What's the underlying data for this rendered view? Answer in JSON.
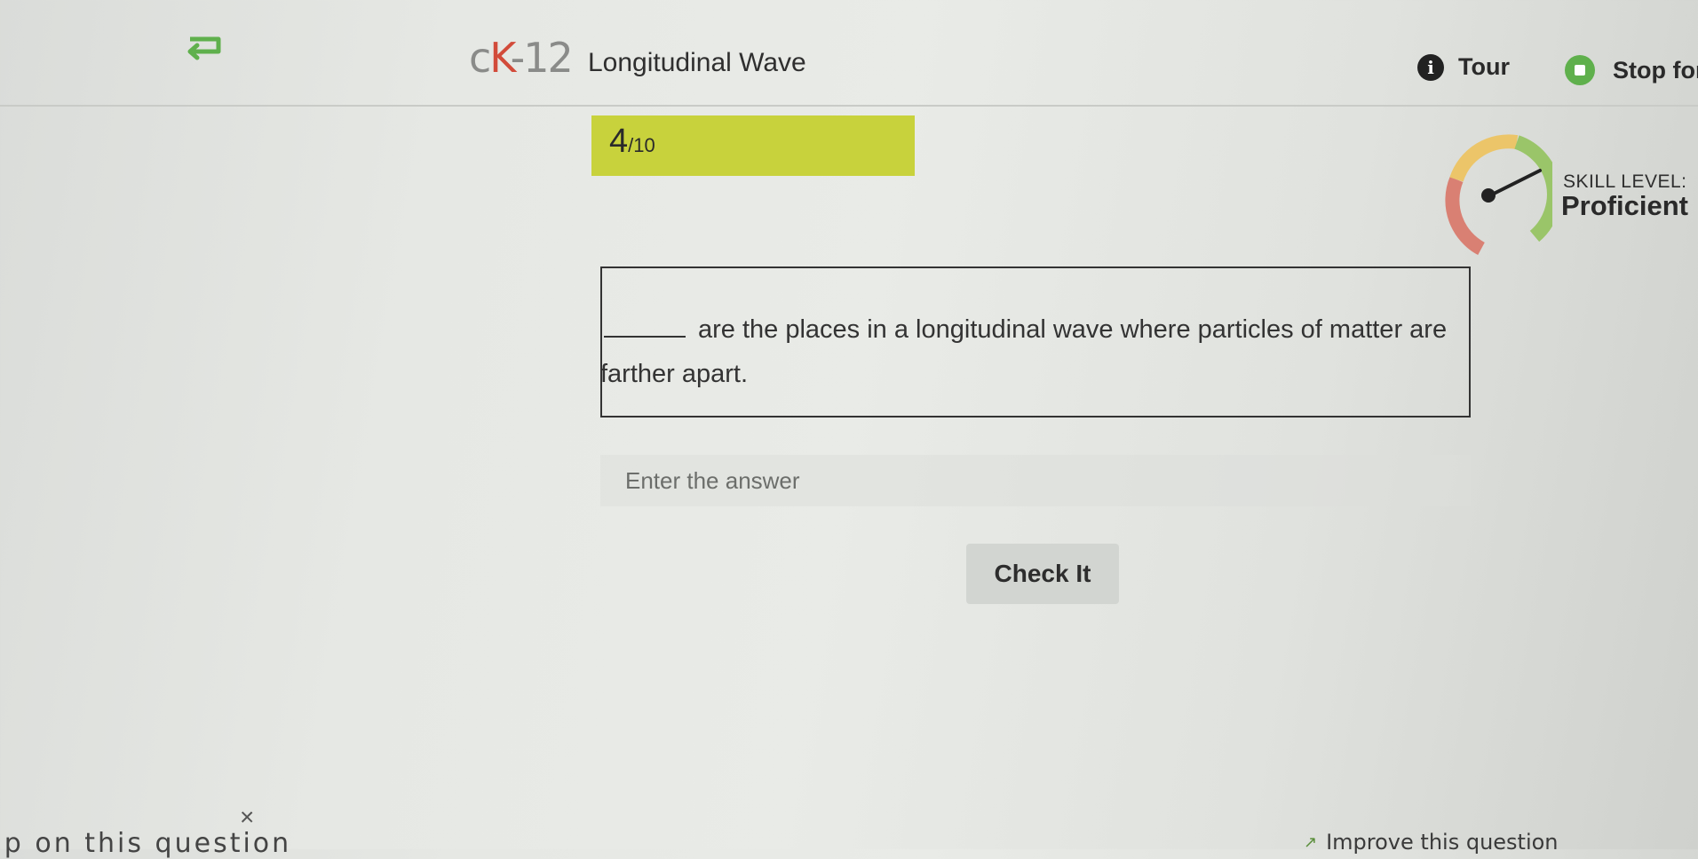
{
  "header": {
    "back_icon": "return-arrow-icon",
    "logo": {
      "c": "c",
      "k": "K",
      "num": "-12"
    },
    "concept_title": "Longitudinal Wave",
    "tour_label": "Tour",
    "tour_icon": "info-icon",
    "stop_label": "Stop for",
    "stop_icon": "stop-icon",
    "brand_green": "#5fb04c",
    "logo_red": "#d24b3a"
  },
  "progress": {
    "current": "4",
    "total": "/10",
    "color": "#c8d23c"
  },
  "skill": {
    "label": "SKILL LEVEL:",
    "value": "Proficient",
    "gauge_icon": "skill-gauge-icon"
  },
  "question": {
    "text_after_blank": "are the places in a longitudinal wave where particles of matter are farther apart."
  },
  "answer": {
    "placeholder": "Enter the answer",
    "value": ""
  },
  "check_label": "Check It",
  "footer": {
    "close_icon": "close-icon",
    "close_glyph": "×",
    "help_text": "elp on this question",
    "improve_icon": "trend-line-icon",
    "improve_label": "Improve this question"
  }
}
